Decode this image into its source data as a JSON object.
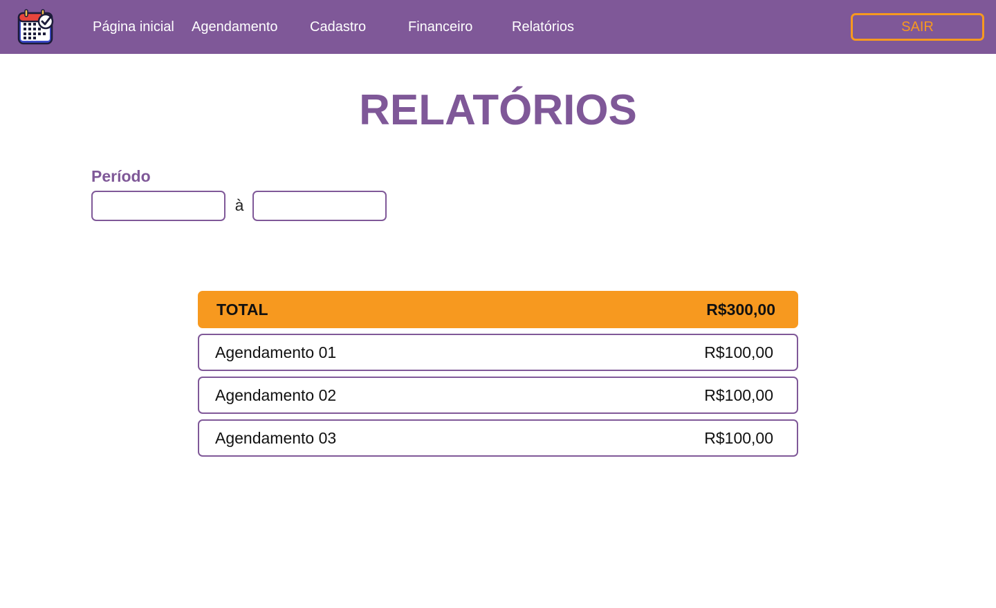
{
  "nav": {
    "items": [
      {
        "label": "Página inicial"
      },
      {
        "label": "Agendamento"
      },
      {
        "label": "Cadastro"
      },
      {
        "label": "Financeiro"
      },
      {
        "label": "Relatórios"
      }
    ],
    "logout_label": "SAIR",
    "logo_icon": "calendar-check-icon"
  },
  "page": {
    "title": "RELATÓRIOS"
  },
  "period": {
    "label": "Período",
    "start_value": "",
    "separator": "à",
    "end_value": ""
  },
  "report": {
    "total_label": "TOTAL",
    "total_value": "R$300,00",
    "rows": [
      {
        "label": "Agendamento 01",
        "value": "R$100,00"
      },
      {
        "label": "Agendamento 02",
        "value": "R$100,00"
      },
      {
        "label": "Agendamento 03",
        "value": "R$100,00"
      }
    ]
  },
  "colors": {
    "primary": "#7f5898",
    "accent": "#f7991f",
    "background": "#ffffff"
  }
}
